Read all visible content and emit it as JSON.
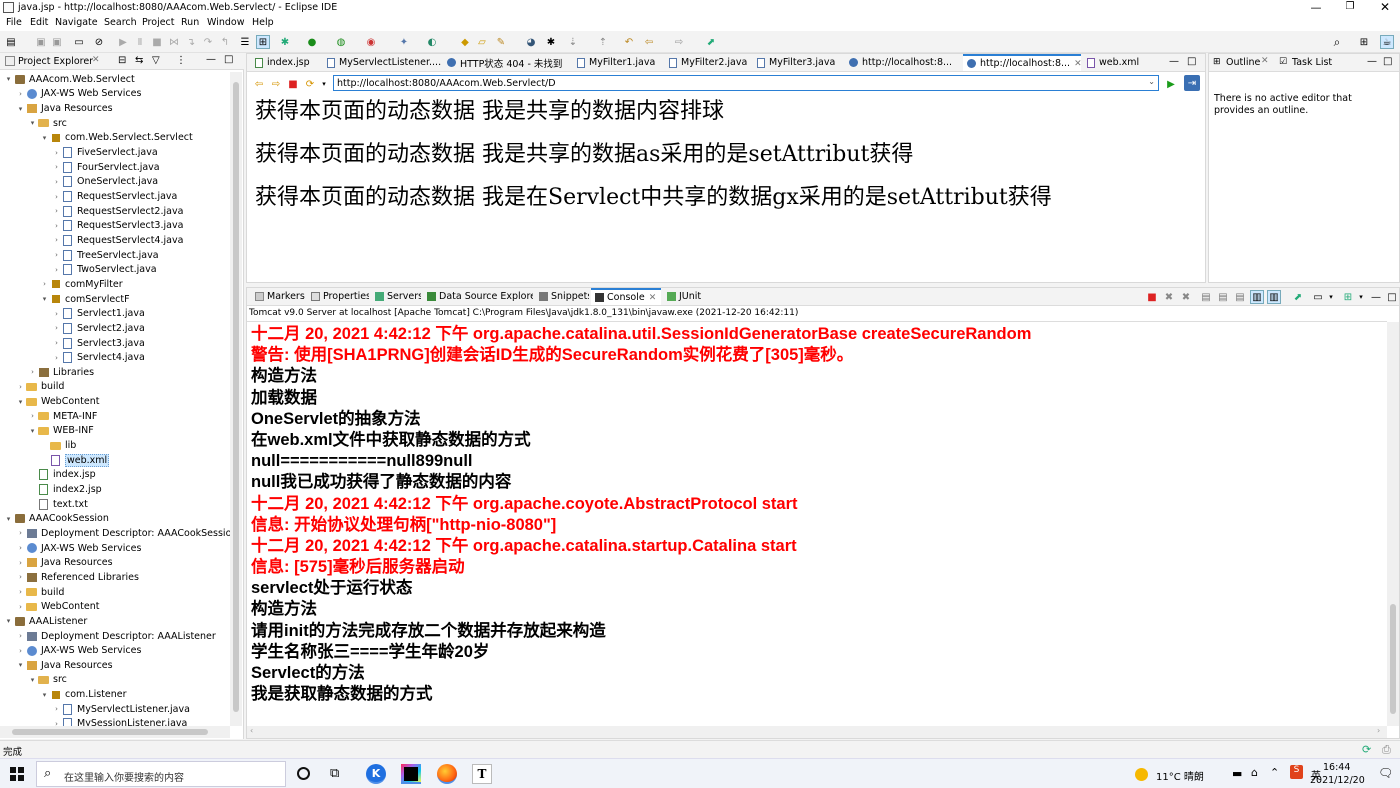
{
  "window": {
    "title": "java.jsp - http://localhost:8080/AAAcom.Web.Servlect/ - Eclipse IDE"
  },
  "menu": [
    "File",
    "Edit",
    "Navigate",
    "Search",
    "Project",
    "Run",
    "Window",
    "Help"
  ],
  "project_explorer": {
    "title": "Project Explorer",
    "items": [
      {
        "label": "AAAcom.Web.Servlect",
        "depth": 0,
        "arrow": "▾",
        "icon": "project-icon"
      },
      {
        "label": "JAX-WS Web Services",
        "depth": 1,
        "arrow": "›",
        "icon": "services-icon"
      },
      {
        "label": "Java Resources",
        "depth": 1,
        "arrow": "▾",
        "icon": "java-resources-icon"
      },
      {
        "label": "src",
        "depth": 2,
        "arrow": "▾",
        "icon": "src-folder-icon"
      },
      {
        "label": "com.Web.Servlect.Servlect",
        "depth": 3,
        "arrow": "▾",
        "icon": "package-icon"
      },
      {
        "label": "FiveServlect.java",
        "depth": 4,
        "arrow": "›",
        "icon": "java-file-icon"
      },
      {
        "label": "FourServlect.java",
        "depth": 4,
        "arrow": "›",
        "icon": "java-file-icon"
      },
      {
        "label": "OneServlect.java",
        "depth": 4,
        "arrow": "›",
        "icon": "java-file-icon"
      },
      {
        "label": "RequestServlect.java",
        "depth": 4,
        "arrow": "›",
        "icon": "java-file-icon"
      },
      {
        "label": "RequestServlect2.java",
        "depth": 4,
        "arrow": "›",
        "icon": "java-file-icon"
      },
      {
        "label": "RequestServlect3.java",
        "depth": 4,
        "arrow": "›",
        "icon": "java-file-icon"
      },
      {
        "label": "RequestServlect4.java",
        "depth": 4,
        "arrow": "›",
        "icon": "java-file-icon"
      },
      {
        "label": "TreeServlect.java",
        "depth": 4,
        "arrow": "›",
        "icon": "java-file-icon"
      },
      {
        "label": "TwoServlect.java",
        "depth": 4,
        "arrow": "›",
        "icon": "java-file-icon"
      },
      {
        "label": "comMyFilter",
        "depth": 3,
        "arrow": "›",
        "icon": "package-icon"
      },
      {
        "label": "comServlectF",
        "depth": 3,
        "arrow": "▾",
        "icon": "package-icon"
      },
      {
        "label": "Servlect1.java",
        "depth": 4,
        "arrow": "›",
        "icon": "java-file-icon"
      },
      {
        "label": "Servlect2.java",
        "depth": 4,
        "arrow": "›",
        "icon": "java-file-icon"
      },
      {
        "label": "Servlect3.java",
        "depth": 4,
        "arrow": "›",
        "icon": "java-file-icon"
      },
      {
        "label": "Servlect4.java",
        "depth": 4,
        "arrow": "›",
        "icon": "java-file-icon"
      },
      {
        "label": "Libraries",
        "depth": 2,
        "arrow": "›",
        "icon": "library-icon"
      },
      {
        "label": "build",
        "depth": 1,
        "arrow": "›",
        "icon": "folder-icon"
      },
      {
        "label": "WebContent",
        "depth": 1,
        "arrow": "▾",
        "icon": "folder-icon"
      },
      {
        "label": "META-INF",
        "depth": 2,
        "arrow": "›",
        "icon": "folder-icon"
      },
      {
        "label": "WEB-INF",
        "depth": 2,
        "arrow": "▾",
        "icon": "folder-icon"
      },
      {
        "label": "lib",
        "depth": 3,
        "arrow": "",
        "icon": "folder-icon"
      },
      {
        "label": "web.xml",
        "depth": 3,
        "arrow": "",
        "icon": "xml-file-icon",
        "selected": true
      },
      {
        "label": "index.jsp",
        "depth": 2,
        "arrow": "",
        "icon": "jsp-file-icon"
      },
      {
        "label": "index2.jsp",
        "depth": 2,
        "arrow": "",
        "icon": "jsp-file-icon"
      },
      {
        "label": "text.txt",
        "depth": 2,
        "arrow": "",
        "icon": "text-file-icon"
      },
      {
        "label": "AAACookSession",
        "depth": 0,
        "arrow": "▾",
        "icon": "project-icon"
      },
      {
        "label": "Deployment Descriptor: AAACookSession",
        "depth": 1,
        "arrow": "›",
        "icon": "descriptor-icon"
      },
      {
        "label": "JAX-WS Web Services",
        "depth": 1,
        "arrow": "›",
        "icon": "services-icon"
      },
      {
        "label": "Java Resources",
        "depth": 1,
        "arrow": "›",
        "icon": "java-resources-icon"
      },
      {
        "label": "Referenced Libraries",
        "depth": 1,
        "arrow": "›",
        "icon": "library-icon"
      },
      {
        "label": "build",
        "depth": 1,
        "arrow": "›",
        "icon": "folder-icon"
      },
      {
        "label": "WebContent",
        "depth": 1,
        "arrow": "›",
        "icon": "folder-icon"
      },
      {
        "label": "AAAListener",
        "depth": 0,
        "arrow": "▾",
        "icon": "project-icon"
      },
      {
        "label": "Deployment Descriptor: AAAListener",
        "depth": 1,
        "arrow": "›",
        "icon": "descriptor-icon"
      },
      {
        "label": "JAX-WS Web Services",
        "depth": 1,
        "arrow": "›",
        "icon": "services-icon"
      },
      {
        "label": "Java Resources",
        "depth": 1,
        "arrow": "▾",
        "icon": "java-resources-icon"
      },
      {
        "label": "src",
        "depth": 2,
        "arrow": "▾",
        "icon": "src-folder-icon"
      },
      {
        "label": "com.Listener",
        "depth": 3,
        "arrow": "▾",
        "icon": "package-icon"
      },
      {
        "label": "MyServlectListener.java",
        "depth": 4,
        "arrow": "›",
        "icon": "java-file-icon"
      },
      {
        "label": "MySessionListener.java",
        "depth": 4,
        "arrow": "›",
        "icon": "java-file-icon"
      }
    ]
  },
  "editor_tabs": [
    {
      "label": "index.jsp",
      "icon": "jsp-file-icon"
    },
    {
      "label": "MyServlectListener....",
      "icon": "java-file-icon"
    },
    {
      "label": "HTTP状态 404 - 未找到",
      "icon": "globe-icon"
    },
    {
      "label": "MyFilter1.java",
      "icon": "java-file-icon"
    },
    {
      "label": "MyFilter2.java",
      "icon": "java-file-icon"
    },
    {
      "label": "MyFilter3.java",
      "icon": "java-file-icon"
    },
    {
      "label": "http://localhost:8...",
      "icon": "globe-icon"
    },
    {
      "label": "http://localhost:8...",
      "icon": "globe-icon",
      "active": true,
      "close": "✕"
    },
    {
      "label": "web.xml",
      "icon": "xml-file-icon"
    }
  ],
  "browser": {
    "url": "http://localhost:8080/AAAcom.Web.Servlect/D",
    "lines": [
      "获得本页面的动态数据 我是共享的数据内容排球",
      "获得本页面的动态数据 我是共享的数据as采用的是setAttribut获得",
      "获得本页面的动态数据 我是在Servlect中共享的数据gx采用的是setAttribut获得"
    ]
  },
  "outline": {
    "tabs": [
      "Outline",
      "Task List"
    ],
    "message": "There is no active editor that provides an outline."
  },
  "bottom_tabs": [
    {
      "label": "Markers",
      "icon": "markers-icon"
    },
    {
      "label": "Properties",
      "icon": "properties-icon"
    },
    {
      "label": "Servers",
      "icon": "servers-icon"
    },
    {
      "label": "Data Source Explorer",
      "icon": "datasource-icon"
    },
    {
      "label": "Snippets",
      "icon": "snippets-icon"
    },
    {
      "label": "Console",
      "icon": "console-icon",
      "active": true,
      "close": "✕"
    },
    {
      "label": "JUnit",
      "icon": "junit-icon"
    }
  ],
  "console": {
    "header": "Tomcat v9.0 Server at localhost [Apache Tomcat] C:\\Program Files\\Java\\jdk1.8.0_131\\bin\\javaw.exe  (2021-12-20 16:42:11)",
    "lines": [
      {
        "text": "十二月 20, 2021 4:42:12 下午 org.apache.catalina.util.SessionIdGeneratorBase createSecureRandom",
        "color": "#ff0000"
      },
      {
        "text": "警告: 使用[SHA1PRNG]创建会话ID生成的SecureRandom实例花费了[305]毫秒。",
        "color": "#ff0000"
      },
      {
        "text": "构造方法",
        "color": "#000000"
      },
      {
        "text": "加载数据",
        "color": "#000000"
      },
      {
        "text": "OneServlet的抽象方法",
        "color": "#000000"
      },
      {
        "text": "在web.xml文件中获取静态数据的方式",
        "color": "#000000"
      },
      {
        "text": "null===========null899null",
        "color": "#000000"
      },
      {
        "text": "null我已成功获得了静态数据的内容",
        "color": "#000000"
      },
      {
        "text": "十二月 20, 2021 4:42:12 下午 org.apache.coyote.AbstractProtocol start",
        "color": "#ff0000"
      },
      {
        "text": "信息: 开始协议处理句柄[\"http-nio-8080\"]",
        "color": "#ff0000"
      },
      {
        "text": "十二月 20, 2021 4:42:12 下午 org.apache.catalina.startup.Catalina start",
        "color": "#ff0000"
      },
      {
        "text": "信息: [575]毫秒后服务器启动",
        "color": "#ff0000"
      },
      {
        "text": "servlect处于运行状态",
        "color": "#000000"
      },
      {
        "text": "构造方法",
        "color": "#000000"
      },
      {
        "text": "请用init的方法完成存放二个数据并存放起来构造",
        "color": "#000000"
      },
      {
        "text": "学生名称张三====学生年龄20岁",
        "color": "#000000"
      },
      {
        "text": "Servlect的方法",
        "color": "#000000"
      },
      {
        "text": "我是获取静态数据的方式",
        "color": "#000000"
      }
    ]
  },
  "status_bar": {
    "text": "完成"
  },
  "taskbar": {
    "search_placeholder": "在这里输入你要搜索的内容",
    "weather": "11°C 晴朗",
    "time": "16:44",
    "date": "2021/12/20",
    "apps": [
      "task-view-icon",
      "kuwo-icon",
      "idea-icon",
      "firefox-icon",
      "typora-icon"
    ]
  },
  "colors": {
    "accent": "#0078d7",
    "console_red": "#ff0000",
    "selection": "#cde8ff"
  }
}
